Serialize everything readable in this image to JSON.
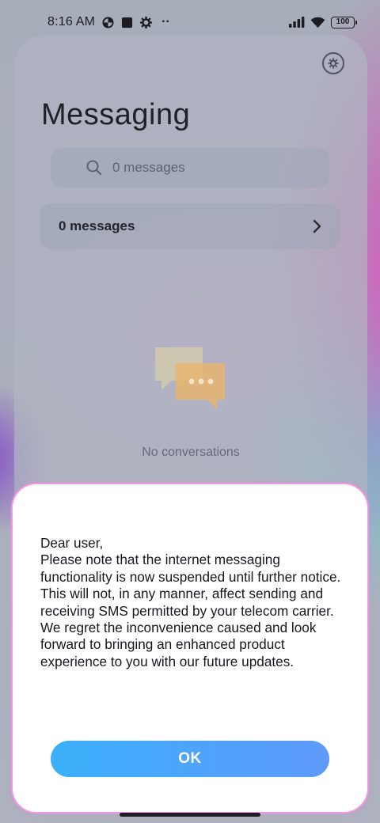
{
  "status_bar": {
    "time": "8:16 AM",
    "battery": "100",
    "more": "··",
    "icons": [
      "data-saver-icon",
      "square-notification-icon",
      "settings-gear-icon",
      "signal-icon",
      "wifi-icon",
      "battery-icon"
    ]
  },
  "app": {
    "title": "Messaging",
    "search": {
      "placeholder": "0 messages"
    },
    "messages_row": {
      "label": "0 messages"
    },
    "empty_state": {
      "label": "No conversations"
    }
  },
  "dialog": {
    "greeting": "Dear user,",
    "body": "Please note that the internet messaging functionality is now suspended until further notice. This will not, in any manner, affect sending and receiving SMS permitted by your telecom carrier. We regret the inconvenience caused and look forward to bringing an enhanced product experience to you with our future updates.",
    "ok_label": "OK"
  },
  "colors": {
    "accent_start": "#3bb0fb",
    "accent_end": "#5f9afa",
    "dialog_border": "#f09ae6",
    "chat_bubble_front": "#e8b46a",
    "chat_bubble_back": "#e3d9a0"
  }
}
